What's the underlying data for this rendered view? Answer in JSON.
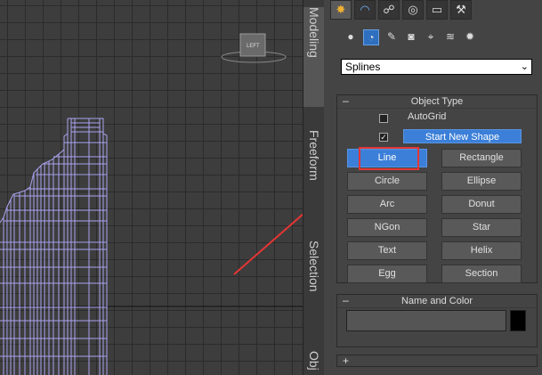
{
  "viewport": {
    "viewcube_label": "LEFT"
  },
  "side_tabs": [
    {
      "label": "Modeling"
    },
    {
      "label": "Freeform"
    },
    {
      "label": "Selection"
    },
    {
      "label": "Obj"
    }
  ],
  "main_tabs": [
    {
      "icon": "sun-icon"
    },
    {
      "icon": "modify-icon"
    },
    {
      "icon": "hierarchy-icon"
    },
    {
      "icon": "motion-icon"
    },
    {
      "icon": "display-icon"
    },
    {
      "icon": "utilities-icon"
    }
  ],
  "sub_tabs": [
    {
      "icon": "geometry-icon"
    },
    {
      "icon": "shapes-icon"
    },
    {
      "icon": "lights-icon"
    },
    {
      "icon": "cameras-icon"
    },
    {
      "icon": "helpers-icon"
    },
    {
      "icon": "spacewarps-icon"
    },
    {
      "icon": "systems-icon"
    }
  ],
  "dropdown": {
    "selected": "Splines"
  },
  "object_type": {
    "title": "Object Type",
    "collapse_sign": "–",
    "autogrid_label": "AutoGrid",
    "start_new_shape_label": "Start New Shape",
    "start_new_shape_checked": "✓",
    "buttons": [
      {
        "label": "Line"
      },
      {
        "label": "Rectangle"
      },
      {
        "label": "Circle"
      },
      {
        "label": "Ellipse"
      },
      {
        "label": "Arc"
      },
      {
        "label": "Donut"
      },
      {
        "label": "NGon"
      },
      {
        "label": "Star"
      },
      {
        "label": "Text"
      },
      {
        "label": "Helix"
      },
      {
        "label": "Egg"
      },
      {
        "label": "Section"
      }
    ]
  },
  "name_and_color": {
    "title": "Name and Color",
    "collapse_sign": "–",
    "color": "#000000"
  },
  "next_rollout": {
    "sign": "+"
  },
  "accent_colors": {
    "highlight": "#e53535",
    "selected": "#3b7fd8"
  }
}
